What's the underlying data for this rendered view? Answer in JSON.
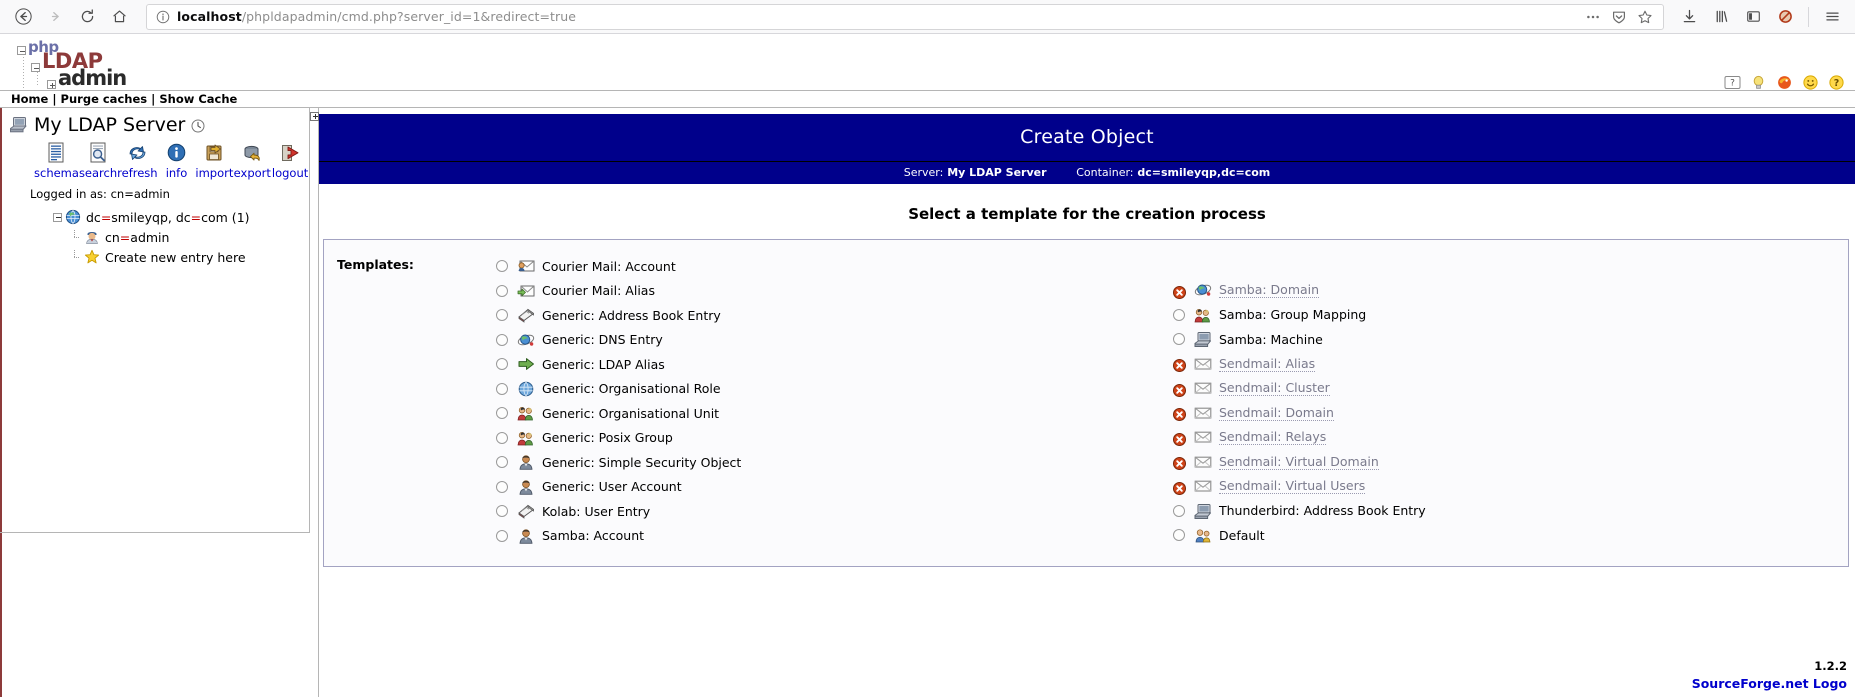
{
  "browser": {
    "back_icon": "back-arrow-icon",
    "forward_icon": "forward-arrow-icon",
    "reload_icon": "reload-icon",
    "home_icon": "home-icon",
    "url_host": "localhost",
    "url_path": "/phpldapadmin/cmd.php?server_id=1&redirect=true",
    "url_full": "localhost/phpldapadmin/cmd.php?server_id=1&redirect=true",
    "identity_icon": "info-circle-icon",
    "page_actions_icon": "ellipsis-icon",
    "pocket_icon": "pocket-shield-icon",
    "bookmark_icon": "star-outline-icon",
    "downloads_icon": "download-arrow-icon",
    "library_icon": "library-icon",
    "sidebar_icon": "sidebar-panel-icon",
    "noscript_icon": "noscript-blocked-icon",
    "menu_icon": "hamburger-menu-icon"
  },
  "app": {
    "logo": {
      "php": "php",
      "ldap": "LDAP",
      "admin": "admin"
    },
    "header_icons": [
      {
        "name": "help-question-icon"
      },
      {
        "name": "lightbulb-icon"
      },
      {
        "name": "firefox-icon"
      },
      {
        "name": "smiley-icon"
      },
      {
        "name": "about-help-icon"
      }
    ],
    "topnav": {
      "home": "Home",
      "purge_caches": "Purge caches",
      "show_cache": "Show Cache",
      "separator": "|"
    }
  },
  "tree": {
    "server_name": "My LDAP Server",
    "server_icon": "server-computer-icon",
    "clock_icon": "clock-icon",
    "toolbar": [
      {
        "label": "schema",
        "icon": "schema-document-icon"
      },
      {
        "label": "search",
        "icon": "search-magnifier-icon"
      },
      {
        "label": "refresh",
        "icon": "refresh-arrows-icon"
      },
      {
        "label": "info",
        "icon": "info-circle-blue-icon"
      },
      {
        "label": "import",
        "icon": "import-floppy-icon"
      },
      {
        "label": "export",
        "icon": "export-database-icon"
      },
      {
        "label": "logout",
        "icon": "logout-door-arrow-icon"
      }
    ],
    "logged_in_as": "Logged in as: cn=admin",
    "root_node": {
      "label": "dc=smileyqp, dc=com (1)",
      "icon": "globe-icon",
      "expander": "minus-box"
    },
    "child_nodes": [
      {
        "label": "cn=admin",
        "icon": "user-admin-icon"
      },
      {
        "label": "Create new entry here",
        "icon": "gold-star-icon"
      }
    ]
  },
  "main": {
    "title": "Create Object",
    "server_label": "Server:",
    "server_value": "My LDAP Server",
    "container_label": "Container:",
    "container_value": "dc=smileyqp,dc=com",
    "heading": "Select a template for the creation process",
    "templates_label": "Templates:",
    "templates_left": [
      {
        "label": "Courier Mail: Account",
        "icon": "mail-user-icon",
        "disabled": false,
        "selected": false
      },
      {
        "label": "Courier Mail: Alias",
        "icon": "mail-arrow-icon",
        "disabled": false,
        "selected": false
      },
      {
        "label": "Generic: Address Book Entry",
        "icon": "address-book-icon",
        "disabled": false,
        "selected": false
      },
      {
        "label": "Generic: DNS Entry",
        "icon": "dns-globe-icon",
        "disabled": false,
        "selected": false
      },
      {
        "label": "Generic: LDAP Alias",
        "icon": "green-arrow-icon",
        "disabled": false,
        "selected": false
      },
      {
        "label": "Generic: Organisational Role",
        "icon": "blue-globe-icon",
        "disabled": false,
        "selected": false
      },
      {
        "label": "Generic: Organisational Unit",
        "icon": "group-people-icon",
        "disabled": false,
        "selected": false
      },
      {
        "label": "Generic: Posix Group",
        "icon": "group-people-icon",
        "disabled": false,
        "selected": false
      },
      {
        "label": "Generic: Simple Security Object",
        "icon": "person-icon",
        "disabled": false,
        "selected": false
      },
      {
        "label": "Generic: User Account",
        "icon": "person-icon",
        "disabled": false,
        "selected": false
      },
      {
        "label": "Kolab: User Entry",
        "icon": "address-book-icon",
        "disabled": false,
        "selected": false
      },
      {
        "label": "Samba: Account",
        "icon": "person-icon",
        "disabled": false,
        "selected": false
      }
    ],
    "templates_right": [
      {
        "label": "Samba: Domain",
        "icon": "dns-globe-icon",
        "disabled": true,
        "selected": false
      },
      {
        "label": "Samba: Group Mapping",
        "icon": "group-people-icon",
        "disabled": false,
        "selected": false
      },
      {
        "label": "Samba: Machine",
        "icon": "machine-computer-icon",
        "disabled": false,
        "selected": false
      },
      {
        "label": "Sendmail: Alias",
        "icon": "envelope-icon",
        "disabled": true,
        "selected": false
      },
      {
        "label": "Sendmail: Cluster",
        "icon": "envelope-icon",
        "disabled": true,
        "selected": false
      },
      {
        "label": "Sendmail: Domain",
        "icon": "envelope-icon",
        "disabled": true,
        "selected": false
      },
      {
        "label": "Sendmail: Relays",
        "icon": "envelope-icon",
        "disabled": true,
        "selected": false
      },
      {
        "label": "Sendmail: Virtual Domain",
        "icon": "envelope-icon",
        "disabled": true,
        "selected": false
      },
      {
        "label": "Sendmail: Virtual Users",
        "icon": "envelope-icon",
        "disabled": true,
        "selected": false
      },
      {
        "label": "Thunderbird: Address Book Entry",
        "icon": "machine-computer-icon",
        "disabled": false,
        "selected": false
      },
      {
        "label": "Default",
        "icon": "default-people-icon",
        "disabled": false,
        "selected": false
      }
    ]
  },
  "footer": {
    "version": "1.2.2",
    "sourceforge": "SourceForge.net Logo"
  },
  "colors": {
    "title_bar": "#00008b",
    "link_blue": "#0000cc",
    "accent_red": "#8d3a3a",
    "disabled_text": "#7a7a8c",
    "panel_border": "#a3a3c2"
  }
}
